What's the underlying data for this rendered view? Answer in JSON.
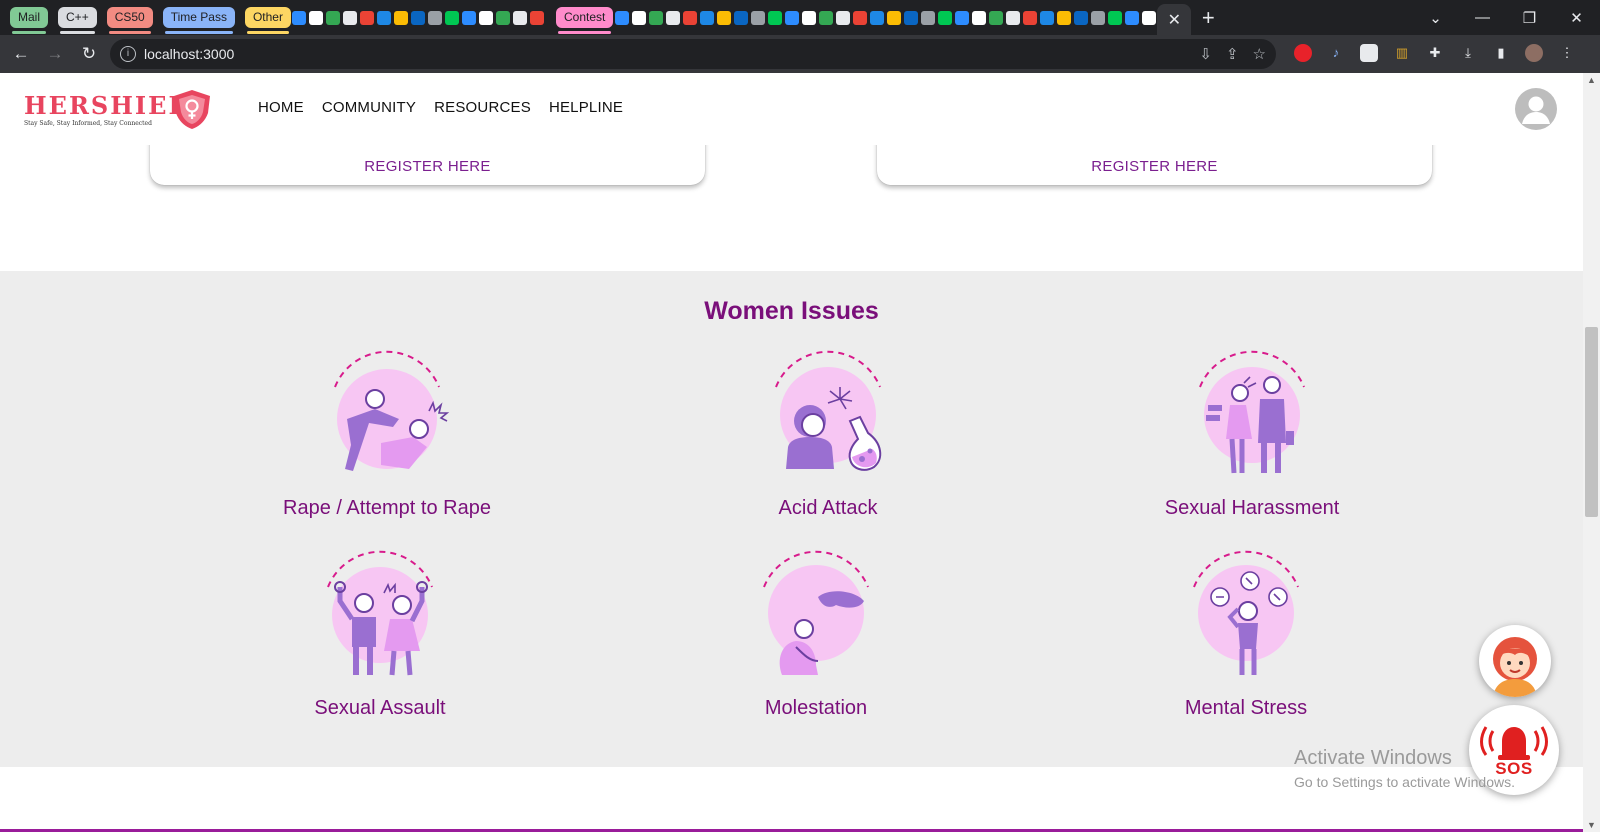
{
  "browser": {
    "tab_groups": [
      {
        "label": "Mail",
        "color": "#81c995"
      },
      {
        "label": "C++",
        "color": "#dadce0"
      },
      {
        "label": "CS50",
        "color": "#f28b82"
      },
      {
        "label": "Time Pass",
        "color": "#8ab4f8"
      },
      {
        "label": "Other",
        "color": "#fdd663"
      },
      {
        "label": "Contest",
        "color": "#ff8bcb"
      }
    ],
    "active_tab_close": "✕",
    "new_tab": "+",
    "url": "localhost:3000",
    "window_controls": {
      "dropdown": "⌄",
      "minimize": "—",
      "restore": "❐",
      "close": "✕"
    }
  },
  "site": {
    "logo_text": "HERSHIELD",
    "logo_tagline": "Stay Safe, Stay Informed, Stay Connected",
    "nav": [
      "HOME",
      "COMMUNITY",
      "RESOURCES",
      "HELPLINE"
    ],
    "register_left": "REGISTER HERE",
    "register_right": "REGISTER HERE",
    "issues_title": "Women Issues",
    "issues": [
      {
        "label": "Rape / Attempt to Rape",
        "icon": "rape-attempt-icon"
      },
      {
        "label": "Acid Attack",
        "icon": "acid-attack-icon"
      },
      {
        "label": "Sexual Harassment",
        "icon": "sexual-harassment-icon"
      },
      {
        "label": "Sexual Assault",
        "icon": "sexual-assault-icon"
      },
      {
        "label": "Molestation",
        "icon": "molestation-icon"
      },
      {
        "label": "Mental Stress",
        "icon": "mental-stress-icon"
      }
    ],
    "sos_label": "SOS",
    "accent_color": "#7a0f7a",
    "illustration_pink": "#f7b6f0",
    "illustration_purple": "#9a6fd1"
  },
  "os_watermark": {
    "line1": "Activate Windows",
    "line2": "Go to Settings to activate Windows."
  }
}
